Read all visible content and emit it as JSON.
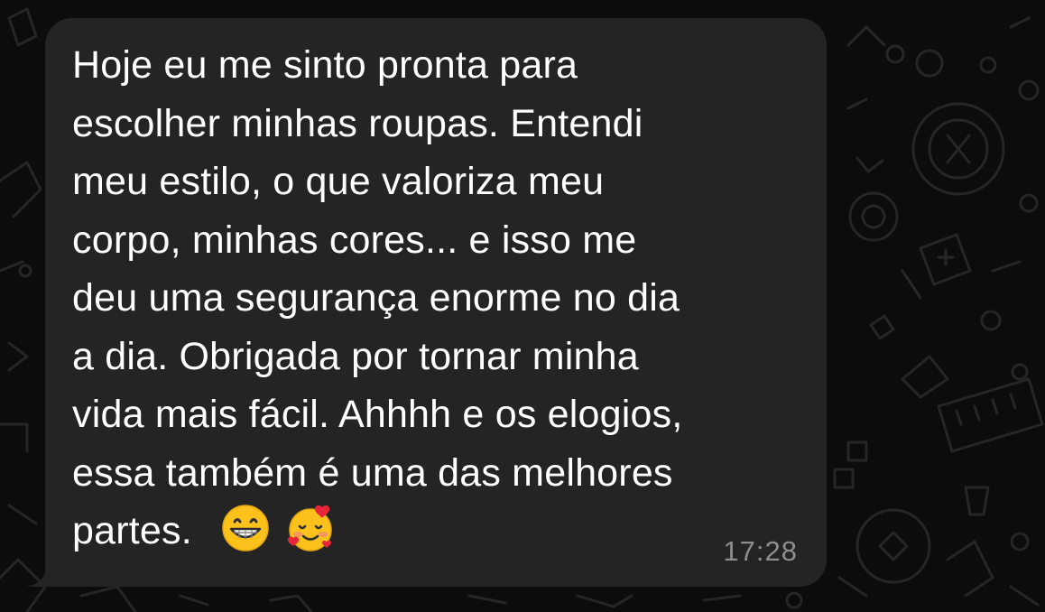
{
  "message": {
    "lines": [
      "Hoje eu me sinto pronta para",
      "escolher minhas roupas. Entendi",
      "meu estilo, o que valoriza meu",
      "corpo, minhas cores... e isso me",
      "deu uma segurança enorme no dia",
      "a dia. Obrigada por tornar minha",
      "vida mais fácil. Ahhhh e os elogios,",
      "essa também é uma das melhores",
      "partes."
    ],
    "emojis": [
      "😁",
      "🥰"
    ],
    "time": "17:28"
  },
  "colors": {
    "background": "#0c0c0c",
    "bubble": "#242424",
    "text": "#ffffff",
    "timestamp": "#8e8e8e"
  }
}
